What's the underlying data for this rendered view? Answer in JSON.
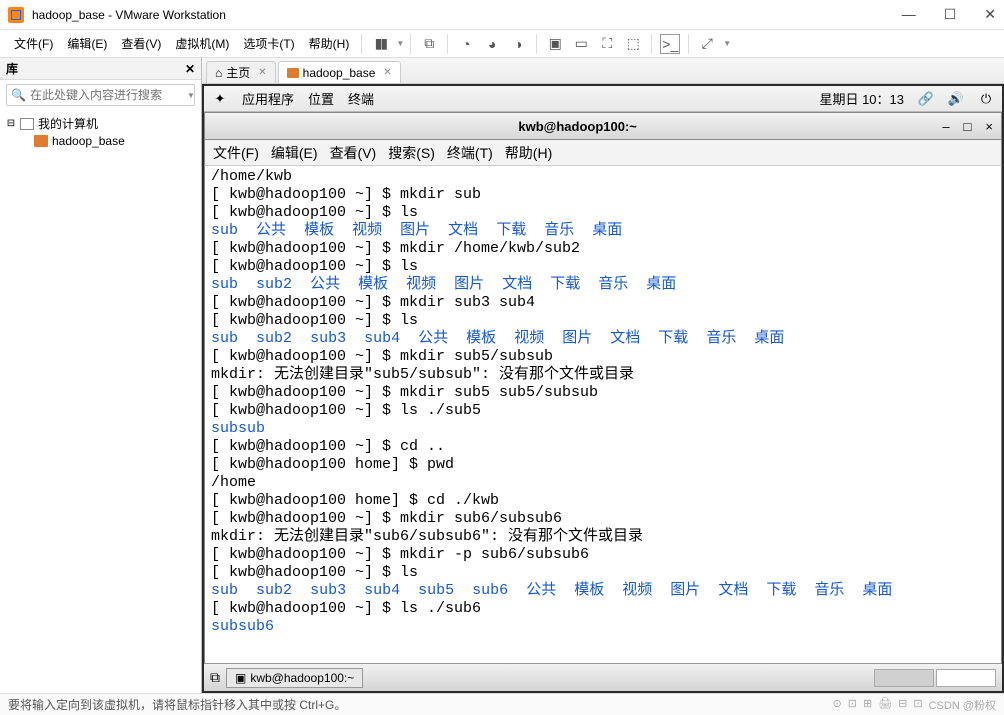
{
  "titlebar": {
    "title": "hadoop_base - VMware Workstation"
  },
  "menubar": {
    "items": [
      "文件(F)",
      "编辑(E)",
      "查看(V)",
      "虚拟机(M)",
      "选项卡(T)",
      "帮助(H)"
    ]
  },
  "sidebar": {
    "title": "库",
    "search_placeholder": "在此处键入内容进行搜索",
    "root": "我的计算机",
    "child": "hadoop_base"
  },
  "tabs": [
    {
      "icon": "home",
      "label": "主页"
    },
    {
      "icon": "vm",
      "label": "hadoop_base"
    }
  ],
  "gnome": {
    "apps": "应用程序",
    "places": "位置",
    "terminal": "终端",
    "clock": "星期日 10：13"
  },
  "terminal_window": {
    "title": "kwb@hadoop100:~",
    "menu": [
      "文件(F)",
      "编辑(E)",
      "查看(V)",
      "搜索(S)",
      "终端(T)",
      "帮助(H)"
    ]
  },
  "prompt": "[ kwb@hadoop100 ~] $ ",
  "prompt_home": "[ kwb@hadoop100 home] $ ",
  "term_lines": [
    {
      "t": "plain",
      "text": "/home/kwb"
    },
    {
      "t": "cmd",
      "text": "mkdir sub"
    },
    {
      "t": "cmd",
      "text": "ls"
    },
    {
      "t": "dirlist",
      "items": [
        "sub",
        "公共",
        "模板",
        "视频",
        "图片",
        "文档",
        "下载",
        "音乐",
        "桌面"
      ]
    },
    {
      "t": "cmd",
      "text": "mkdir /home/kwb/sub2"
    },
    {
      "t": "cmd",
      "text": "ls"
    },
    {
      "t": "dirlist",
      "items": [
        "sub",
        "sub2",
        "公共",
        "模板",
        "视频",
        "图片",
        "文档",
        "下载",
        "音乐",
        "桌面"
      ]
    },
    {
      "t": "cmd",
      "text": "mkdir sub3 sub4"
    },
    {
      "t": "cmd",
      "text": "ls"
    },
    {
      "t": "dirlist",
      "items": [
        "sub",
        "sub2",
        "sub3",
        "sub4",
        "公共",
        "模板",
        "视频",
        "图片",
        "文档",
        "下载",
        "音乐",
        "桌面"
      ]
    },
    {
      "t": "cmd",
      "text": "mkdir sub5/subsub"
    },
    {
      "t": "plain",
      "text": "mkdir: 无法创建目录\"sub5/subsub\": 没有那个文件或目录"
    },
    {
      "t": "cmd",
      "text": "mkdir sub5 sub5/subsub"
    },
    {
      "t": "cmd",
      "text": "ls ./sub5"
    },
    {
      "t": "blue",
      "text": "subsub"
    },
    {
      "t": "cmd",
      "text": "cd .."
    },
    {
      "t": "cmd_home",
      "text": "pwd"
    },
    {
      "t": "plain",
      "text": "/home"
    },
    {
      "t": "cmd_home",
      "text": "cd ./kwb"
    },
    {
      "t": "cmd",
      "text": "mkdir sub6/subsub6"
    },
    {
      "t": "plain",
      "text": "mkdir: 无法创建目录\"sub6/subsub6\": 没有那个文件或目录"
    },
    {
      "t": "cmd",
      "text": "mkdir -p sub6/subsub6"
    },
    {
      "t": "cmd",
      "text": "ls"
    },
    {
      "t": "dirlist",
      "items": [
        "sub",
        "sub2",
        "sub3",
        "sub4",
        "sub5",
        "sub6",
        "公共",
        "模板",
        "视频",
        "图片",
        "文档",
        "下载",
        "音乐",
        "桌面"
      ]
    },
    {
      "t": "cmd",
      "text": "ls ./sub6"
    },
    {
      "t": "blue",
      "text": "subsub6"
    }
  ],
  "taskbar": {
    "task": "kwb@hadoop100:~"
  },
  "statusbar": {
    "text": "要将输入定向到该虚拟机，请将鼠标指针移入其中或按 Ctrl+G。",
    "watermark": "CSDN @粉权"
  }
}
